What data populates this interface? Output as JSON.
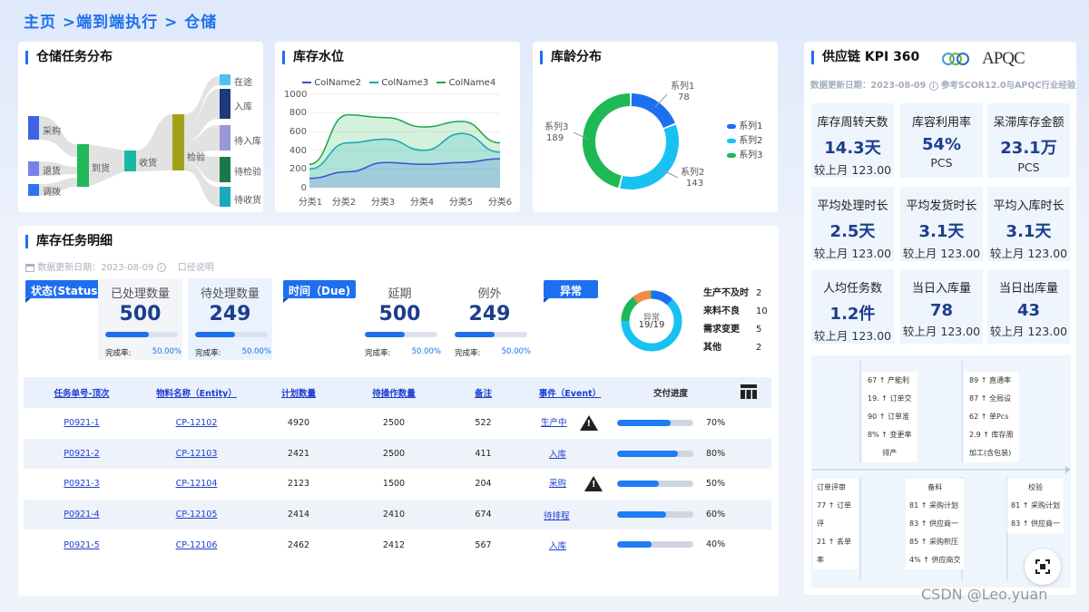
{
  "breadcrumb": "主页 >端到端执行 > 仓储",
  "sankey": {
    "title": "仓储任务分布",
    "nodes": [
      "采购",
      "退货",
      "调拨",
      "到货",
      "收货",
      "检验",
      "在途",
      "入库",
      "待入库",
      "待检验",
      "待收货"
    ]
  },
  "stock": {
    "title": "库存水位",
    "legend": [
      "ColName2",
      "ColName3",
      "ColName4"
    ],
    "yticks": [
      "1000",
      "800",
      "600",
      "400",
      "200",
      "0"
    ],
    "xticks": [
      "分类1",
      "分类2",
      "分类3",
      "分类4",
      "分类5",
      "分类6"
    ]
  },
  "chart_data": [
    {
      "type": "area",
      "title": "库存水位",
      "categories": [
        "分类1",
        "分类2",
        "分类3",
        "分类4",
        "分类5",
        "分类6"
      ],
      "ylim": [
        0,
        1000
      ],
      "series": [
        {
          "name": "ColName2",
          "values": [
            100,
            170,
            270,
            250,
            270,
            310
          ]
        },
        {
          "name": "ColName3",
          "values": [
            200,
            480,
            520,
            400,
            580,
            380
          ]
        },
        {
          "name": "ColName4",
          "values": [
            250,
            780,
            750,
            650,
            710,
            480
          ]
        }
      ]
    },
    {
      "type": "pie",
      "title": "库龄分布",
      "labels": [
        "系列1",
        "系列2",
        "系列3"
      ],
      "values": [
        78,
        143,
        189
      ]
    }
  ],
  "age": {
    "title": "库龄分布",
    "legend": [
      "系列1",
      "系列2",
      "系列3"
    ],
    "labels": [
      {
        "name": "系列1",
        "value": "78"
      },
      {
        "name": "系列2",
        "value": "143"
      },
      {
        "name": "系列3",
        "value": "189"
      }
    ]
  },
  "detail": {
    "title": "库存任务明细",
    "update": "数据更新日期：2023-08-09",
    "caliber": "口径说明",
    "status_flag": "状态(Status)",
    "due_flag": "时间（Due)",
    "abn_flag": "异常",
    "stats": [
      {
        "label": "已处理数量",
        "value": "500",
        "rate_label": "完成率:",
        "rate": "50.00%"
      },
      {
        "label": "待处理数量",
        "value": "249",
        "rate_label": "完成率:",
        "rate": "50.00%"
      },
      {
        "label": "延期",
        "value": "500",
        "rate_label": "完成率:",
        "rate": "50.00%"
      },
      {
        "label": "例外",
        "value": "249",
        "rate_label": "完成率:",
        "rate": "50.00%"
      }
    ],
    "abn_center": "异常",
    "abn_count": "19/19",
    "abn_list": [
      {
        "name": "生产不及时",
        "count": "2"
      },
      {
        "name": "来料不良",
        "count": "10"
      },
      {
        "name": "需求变更",
        "count": "5"
      },
      {
        "name": "其他",
        "count": "2"
      }
    ],
    "headers": [
      "任务单号-顶次",
      "物料名称（Entity）",
      "计划数量",
      "待操作数量",
      "备注",
      "事件（Event）",
      "交付进度"
    ],
    "rows": [
      {
        "id": "P0921-1",
        "entity": "CP-12102",
        "plan": "4920",
        "pending": "2500",
        "note": "522",
        "event": "生产中",
        "warn": true,
        "progress": "70%",
        "p": 0.7
      },
      {
        "id": "P0921-2",
        "entity": "CP-12103",
        "plan": "2421",
        "pending": "2500",
        "note": "411",
        "event": "入库",
        "warn": false,
        "progress": "80%",
        "p": 0.8
      },
      {
        "id": "P0921-3",
        "entity": "CP-12104",
        "plan": "2123",
        "pending": "1500",
        "note": "204",
        "event": "采购",
        "warn": true,
        "progress": "50%",
        "p": 0.5
      },
      {
        "id": "P0921-4",
        "entity": "CP-12105",
        "plan": "2414",
        "pending": "2410",
        "note": "674",
        "event": "待排程",
        "warn": false,
        "progress": "60%",
        "p": 0.6
      },
      {
        "id": "P0921-5",
        "entity": "CP-12106",
        "plan": "2462",
        "pending": "2412",
        "note": "567",
        "event": "入库",
        "warn": false,
        "progress": "40%",
        "p": 0.4
      }
    ]
  },
  "kpi": {
    "title": "供应链 KPI 360",
    "logo": "APQC",
    "update": "数据更新日期：2023-08-09",
    "ref": "参考SCOR12.0与APQC行业经验",
    "items": [
      {
        "label": "库存周转天数",
        "value": "14.3天",
        "sub": "较上月 123.00"
      },
      {
        "label": "库容利用率",
        "value": "54%",
        "sub": "PCS"
      },
      {
        "label": "呆滞库存金额",
        "value": "23.1万",
        "sub": "PCS"
      },
      {
        "label": "平均处理时长",
        "value": "2.5天",
        "sub": "较上月 123.00"
      },
      {
        "label": "平均发货时长",
        "value": "3.1天",
        "sub": "较上月 123.00"
      },
      {
        "label": "平均入库时长",
        "value": "3.1天",
        "sub": "较上月 123.00"
      },
      {
        "label": "人均任务数",
        "value": "1.2件",
        "sub": "较上月 123.00"
      },
      {
        "label": "当日入库量",
        "value": "78",
        "sub": "较上月 123.00"
      },
      {
        "label": "当日出库量",
        "value": "43",
        "sub": "较上月 123.00"
      }
    ],
    "fish_top_left": [
      "67 ↑  产能利",
      "19. ↑  订单交",
      "90 ↑  订单准",
      "8% ↑  变更率",
      "排产"
    ],
    "fish_top_right": [
      "89 ↑  直通率",
      "87 ↑  全局设",
      "62 ↑  单Pcs",
      "2.9 ↑  库存周",
      "加工(含包装)"
    ],
    "fish_b1": [
      "订单评审",
      "77 ↑  订单评",
      "21 ↑  丢单率"
    ],
    "fish_b2": [
      "备料",
      "81 ↑  采购计划",
      "83 ↑  供应商一",
      "85 ↑  采购积压",
      "4% ↑  供应商交"
    ],
    "fish_b3": [
      "校验",
      "81 ↑  采购计划",
      "83 ↑  供应商一"
    ]
  },
  "watermark": "CSDN @Leo.yuan"
}
